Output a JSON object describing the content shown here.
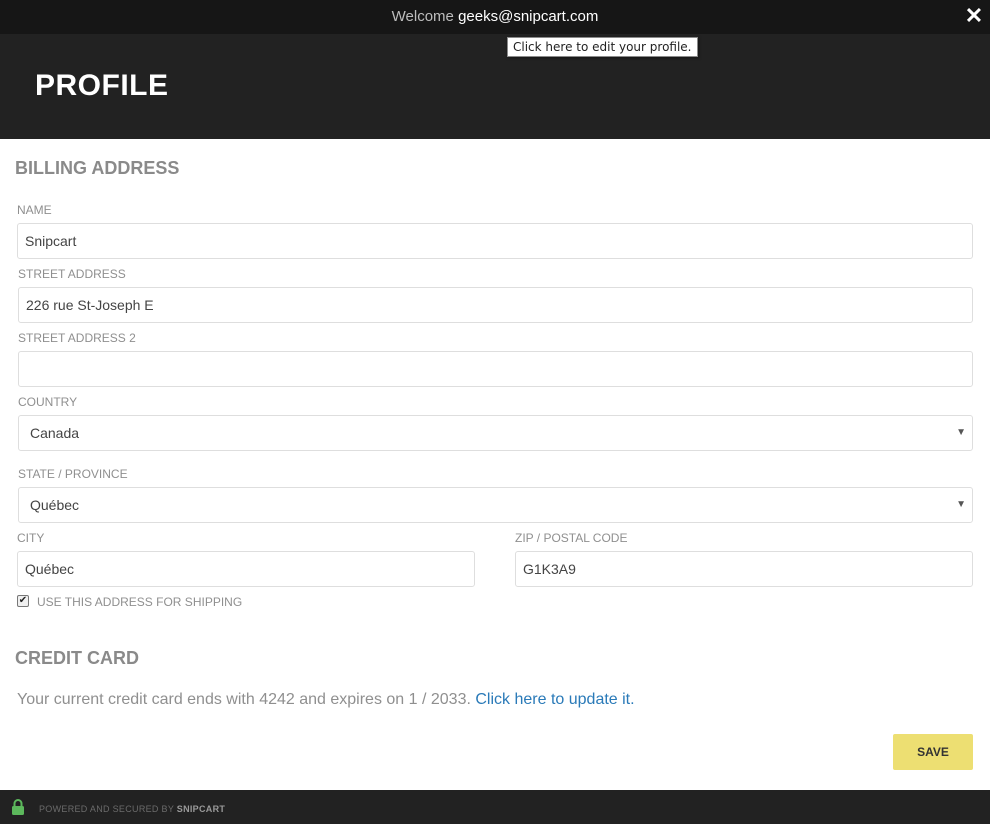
{
  "topbar": {
    "welcome_prefix": "Welcome",
    "email": "geeks@snipcart.com",
    "close_icon": "close-icon",
    "tooltip": "Click here to edit your profile."
  },
  "header": {
    "title": "PROFILE"
  },
  "billing": {
    "title": "BILLING ADDRESS",
    "name_label": "NAME",
    "name_value": "Snipcart",
    "street_label": "STREET ADDRESS",
    "street_value": "226 rue St-Joseph E",
    "street2_label": "STREET ADDRESS 2",
    "street2_value": "",
    "country_label": "COUNTRY",
    "country_value": "Canada",
    "state_label": "STATE / PROVINCE",
    "state_value": "Québec",
    "city_label": "CITY",
    "city_value": "Québec",
    "zip_label": "ZIP / POSTAL CODE",
    "zip_value": "G1K3A9",
    "shipping_checkbox_label": "USE THIS ADDRESS FOR SHIPPING",
    "shipping_checked": true
  },
  "credit_card": {
    "title": "CREDIT CARD",
    "text": "Your current credit card ends with 4242 and expires on 1 / 2033.",
    "update_link": "Click here to update it."
  },
  "actions": {
    "save_label": "SAVE"
  },
  "footer": {
    "powered_text": "POWERED AND SECURED BY",
    "brand": "SNIPCART",
    "lock_icon": "lock-icon"
  },
  "colors": {
    "save_button": "#eddf72",
    "header_bg": "#222222",
    "topbar_bg": "#161616",
    "link": "#2a7ab8",
    "lock": "#5cb85c"
  }
}
